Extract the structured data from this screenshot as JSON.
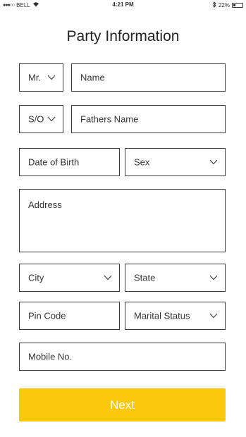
{
  "status_bar": {
    "carrier": "BELL",
    "time": "4:21 PM",
    "battery": "22%",
    "battery_level": 0.22
  },
  "page": {
    "title": "Party Information"
  },
  "form": {
    "salutation": "Mr.",
    "name_placeholder": "Name",
    "relation": "S/O",
    "father_name_placeholder": "Fathers Name",
    "dob_placeholder": "Date of Birth",
    "sex_placeholder": "Sex",
    "address_placeholder": "Address",
    "city_placeholder": "City",
    "state_placeholder": "State",
    "pin_placeholder": "Pin Code",
    "marital_placeholder": "Marital Status",
    "mobile_placeholder": "Mobile No."
  },
  "actions": {
    "next_label": "Next"
  },
  "colors": {
    "accent": "#fcc80c",
    "border": "#3a3a3a"
  }
}
